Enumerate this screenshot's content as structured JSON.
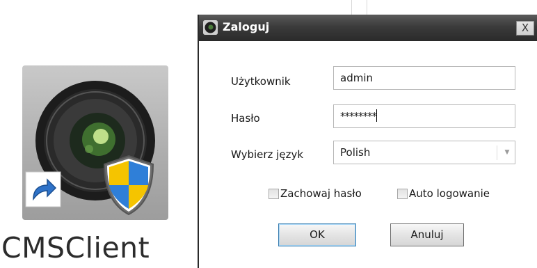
{
  "desktop": {
    "icon_label": "CMSClient",
    "icon_name": "camera-shield-icon"
  },
  "dialog": {
    "title": "Zaloguj",
    "close_glyph": "X",
    "fields": {
      "username_label": "Użytkownik",
      "username_value": "admin",
      "password_label": "Hasło",
      "password_value": "********",
      "language_label": "Wybierz język",
      "language_value": "Polish"
    },
    "checkboxes": {
      "save_password_label": "Zachowaj hasło",
      "save_password_checked": false,
      "auto_login_label": "Auto logowanie",
      "auto_login_checked": false
    },
    "buttons": {
      "ok_label": "OK",
      "cancel_label": "Anuluj"
    }
  },
  "colors": {
    "titlebar": "#3b3b3b",
    "title_text": "#ffffff",
    "focus_border": "#3c7fb1",
    "shield_blue": "#2f7fd8",
    "shield_yellow": "#f5c400"
  }
}
